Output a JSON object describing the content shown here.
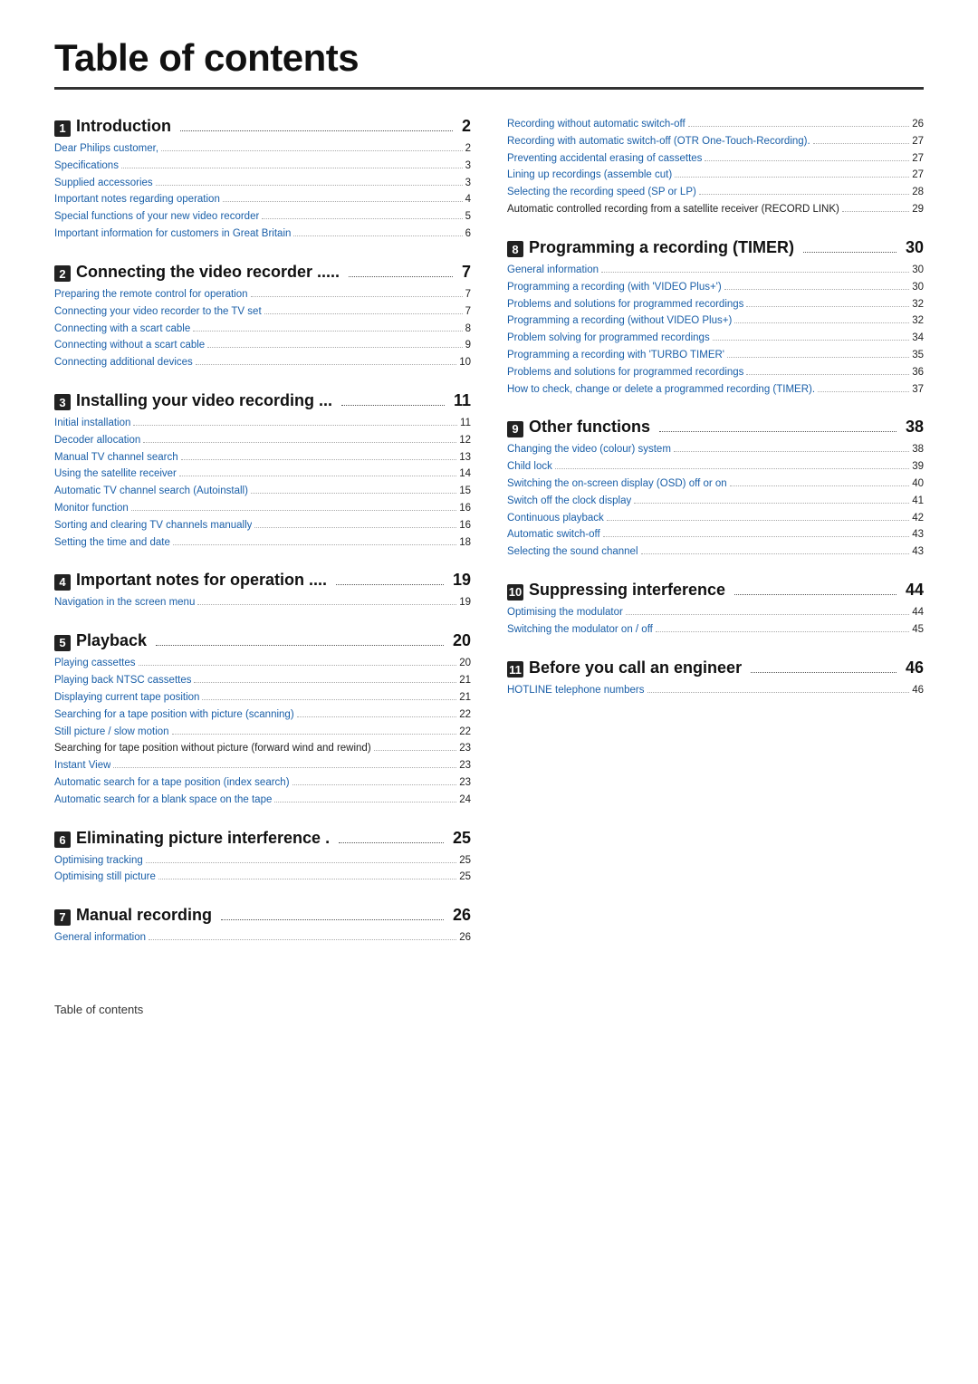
{
  "title": "Table of contents",
  "footer": "Table of contents",
  "left_col": [
    {
      "num": "1",
      "title": "Introduction",
      "dots": true,
      "page": "2",
      "entries": [
        {
          "text": "Dear Philips customer,",
          "page": "2",
          "color": "blue"
        },
        {
          "text": "Specifications",
          "page": "3",
          "color": "blue"
        },
        {
          "text": "Supplied accessories",
          "page": "3",
          "color": "blue"
        },
        {
          "text": "Important notes regarding operation",
          "page": "4",
          "color": "blue"
        },
        {
          "text": "Special functions of your new video recorder",
          "page": "5",
          "color": "blue"
        },
        {
          "text": "Important information for customers in Great Britain",
          "page": "6",
          "color": "blue"
        }
      ]
    },
    {
      "num": "2",
      "title": "Connecting the video recorder .....",
      "dots": false,
      "page": "7",
      "entries": [
        {
          "text": "Preparing the remote control for operation",
          "page": "7",
          "color": "blue"
        },
        {
          "text": "Connecting your video recorder to the TV set",
          "page": "7",
          "color": "blue"
        },
        {
          "text": "Connecting with a scart cable",
          "page": "8",
          "color": "blue"
        },
        {
          "text": "Connecting without a scart cable",
          "page": "9",
          "color": "blue"
        },
        {
          "text": "Connecting additional devices",
          "page": "10",
          "color": "blue"
        }
      ]
    },
    {
      "num": "3",
      "title": "Installing your video recording ...",
      "dots": false,
      "page": "11",
      "entries": [
        {
          "text": "Initial installation",
          "page": "11",
          "color": "blue"
        },
        {
          "text": "Decoder allocation",
          "page": "12",
          "color": "blue"
        },
        {
          "text": "Manual TV channel search",
          "page": "13",
          "color": "blue"
        },
        {
          "text": "Using the satellite receiver",
          "page": "14",
          "color": "blue"
        },
        {
          "text": "Automatic TV channel search (Autoinstall)",
          "page": "15",
          "color": "blue"
        },
        {
          "text": "Monitor function",
          "page": "16",
          "color": "blue"
        },
        {
          "text": "Sorting and clearing TV channels manually",
          "page": "16",
          "color": "blue"
        },
        {
          "text": "Setting the time and date",
          "page": "18",
          "color": "blue"
        }
      ]
    },
    {
      "num": "4",
      "title": "Important notes for operation ....",
      "dots": false,
      "page": "19",
      "entries": [
        {
          "text": "Navigation in the screen menu",
          "page": "19",
          "color": "blue"
        }
      ]
    },
    {
      "num": "5",
      "title": "Playback",
      "dots": true,
      "page": "20",
      "entries": [
        {
          "text": "Playing cassettes",
          "page": "20",
          "color": "blue"
        },
        {
          "text": "Playing back NTSC cassettes",
          "page": "21",
          "color": "blue"
        },
        {
          "text": "Displaying current tape position",
          "page": "21",
          "color": "blue"
        },
        {
          "text": "Searching for a tape position with picture (scanning)",
          "page": "22",
          "color": "blue"
        },
        {
          "text": "Still picture / slow motion",
          "page": "22",
          "color": "blue"
        },
        {
          "text": "Searching for tape position without picture (forward wind and rewind)",
          "page": "23",
          "color": "black"
        },
        {
          "text": "Instant View",
          "page": "23",
          "color": "blue"
        },
        {
          "text": "Automatic search for a tape position (index search)",
          "page": "23",
          "color": "blue"
        },
        {
          "text": "Automatic search for a blank space on the tape",
          "page": "24",
          "color": "blue"
        }
      ]
    },
    {
      "num": "6",
      "title": "Eliminating picture interference .",
      "dots": false,
      "page": "25",
      "entries": [
        {
          "text": "Optimising tracking",
          "page": "25",
          "color": "blue"
        },
        {
          "text": "Optimising still picture",
          "page": "25",
          "color": "blue"
        }
      ]
    },
    {
      "num": "7",
      "title": "Manual recording",
      "dots": true,
      "page": "26",
      "entries": [
        {
          "text": "General information",
          "page": "26",
          "color": "blue"
        }
      ]
    }
  ],
  "right_col": [
    {
      "num": null,
      "title": null,
      "page": null,
      "entries": [
        {
          "text": "Recording without automatic switch-off",
          "page": "26",
          "color": "blue"
        },
        {
          "text": "Recording with automatic switch-off (OTR One-Touch-Recording).",
          "page": "27",
          "color": "blue"
        },
        {
          "text": "Preventing accidental erasing of cassettes",
          "page": "27",
          "color": "blue"
        },
        {
          "text": "Lining up recordings (assemble cut)",
          "page": "27",
          "color": "blue"
        },
        {
          "text": "Selecting the recording speed (SP or LP)",
          "page": "28",
          "color": "blue"
        },
        {
          "text": "Automatic controlled recording from a satellite receiver (RECORD LINK)",
          "page": "29",
          "color": "black"
        }
      ]
    },
    {
      "num": "8",
      "title": "Programming a recording (TIMER)",
      "dots": true,
      "page": "30",
      "entries": [
        {
          "text": "General information",
          "page": "30",
          "color": "blue"
        },
        {
          "text": "Programming a recording (with 'VIDEO Plus+')",
          "page": "30",
          "color": "blue"
        },
        {
          "text": "Problems and solutions for programmed recordings",
          "page": "32",
          "color": "blue"
        },
        {
          "text": "Programming a recording (without VIDEO Plus+)",
          "page": "32",
          "color": "blue"
        },
        {
          "text": "Problem solving for programmed recordings",
          "page": "34",
          "color": "blue"
        },
        {
          "text": "Programming a recording with 'TURBO TIMER'",
          "page": "35",
          "color": "blue"
        },
        {
          "text": "Problems and solutions for programmed recordings",
          "page": "36",
          "color": "blue"
        },
        {
          "text": "How to check, change or delete a programmed recording (TIMER).",
          "page": "37",
          "color": "blue"
        }
      ]
    },
    {
      "num": "9",
      "title": "Other functions",
      "dots": true,
      "page": "38",
      "entries": [
        {
          "text": "Changing the video (colour) system",
          "page": "38",
          "color": "blue"
        },
        {
          "text": "Child lock",
          "page": "39",
          "color": "blue"
        },
        {
          "text": "Switching the on-screen display (OSD) off or on",
          "page": "40",
          "color": "blue"
        },
        {
          "text": "Switch off the clock display",
          "page": "41",
          "color": "blue"
        },
        {
          "text": "Continuous playback",
          "page": "42",
          "color": "blue"
        },
        {
          "text": "Automatic switch-off",
          "page": "43",
          "color": "blue"
        },
        {
          "text": "Selecting the sound channel",
          "page": "43",
          "color": "blue"
        }
      ]
    },
    {
      "num": "10",
      "title": "Suppressing interference",
      "dots": true,
      "page": "44",
      "entries": [
        {
          "text": "Optimising the modulator",
          "page": "44",
          "color": "blue"
        },
        {
          "text": "Switching the modulator on / off",
          "page": "45",
          "color": "blue"
        }
      ]
    },
    {
      "num": "11",
      "title": "Before you call an engineer",
      "dots": true,
      "page": "46",
      "entries": [
        {
          "text": "HOTLINE telephone numbers",
          "page": "46",
          "color": "blue"
        }
      ]
    }
  ]
}
